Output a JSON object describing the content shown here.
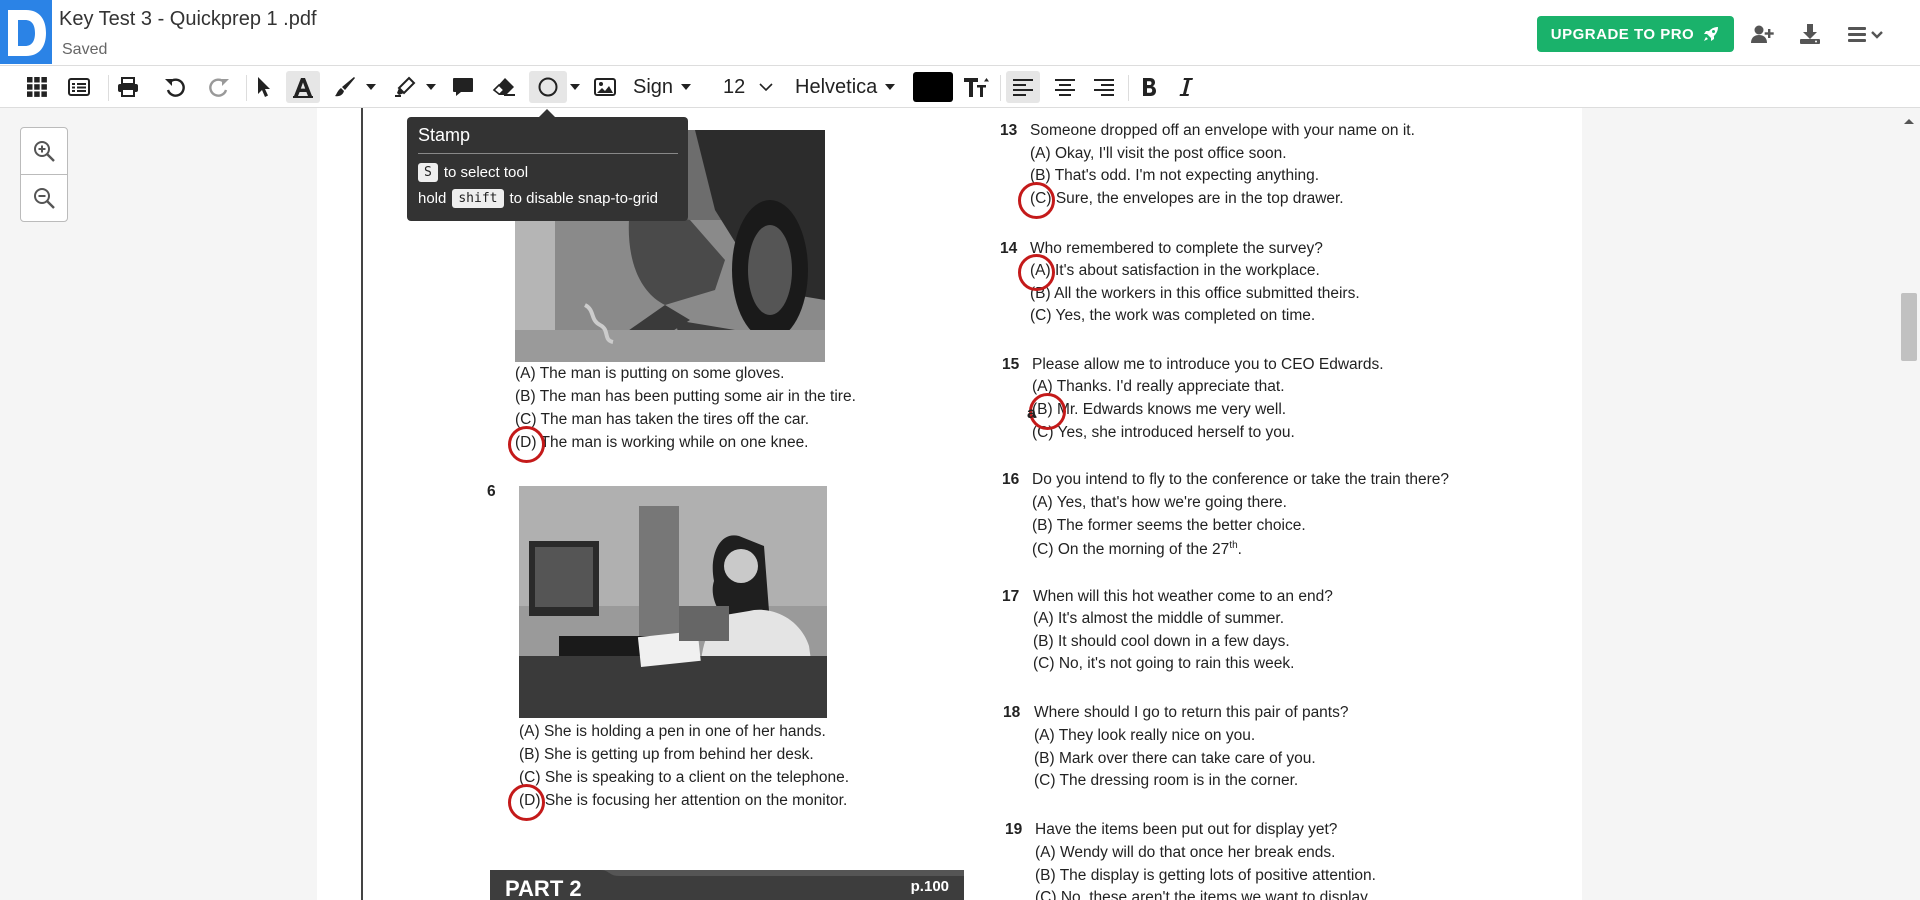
{
  "header": {
    "title": "Key Test 3 - Quickprep 1 .pdf",
    "status": "Saved",
    "upgrade_label": "UPGRADE TO PRO"
  },
  "toolbar": {
    "sign_label": "Sign",
    "font_size": "12",
    "font_family": "Helvetica",
    "text_color": "#000000"
  },
  "tooltip": {
    "title": "Stamp",
    "key1": "S",
    "line1": "to select tool",
    "prefix2": "hold",
    "key2": "shift",
    "line2": "to disable snap-to-grid"
  },
  "colors": {
    "brand": "#2b83e6",
    "upgrade": "#1ab26b",
    "annotation": "#c41a1a"
  },
  "document": {
    "q5": {
      "options": [
        "(A) The man is putting on some gloves.",
        "(B) The man has been putting some air in the tire.",
        "(C) The man has taken the tires off the car.",
        "(D) The man is working while on one knee."
      ]
    },
    "q6": {
      "number": "6",
      "options": [
        "(A) She is holding a pen in one of her hands.",
        "(B) She is getting up from behind her desk.",
        "(C) She is speaking to a client on the telephone.",
        "(D) She is focusing her attention on the monitor."
      ]
    },
    "q13": {
      "number": "13",
      "question": "Someone dropped off an envelope with your name on it.",
      "options": [
        "(A) Okay, I'll visit the post office soon.",
        "(B) That's odd. I'm not expecting anything.",
        "(C) Sure, the envelopes are in the top drawer."
      ]
    },
    "q14": {
      "number": "14",
      "question": "Who remembered to complete the survey?",
      "options": [
        "(A) It's about satisfaction in the workplace.",
        "(B) All the workers in this office submitted theirs.",
        "(C) Yes, the work was completed on time."
      ]
    },
    "q15": {
      "number": "15",
      "question": "Please allow me to introduce you to CEO Edwards.",
      "options": [
        "(A) Thanks. I'd really appreciate that.",
        "(B) Mr. Edwards knows me very well.",
        "(C) Yes, she introduced herself to you."
      ],
      "annotation_text": "a"
    },
    "q16": {
      "number": "16",
      "question": "Do you intend to fly to the conference or take the train there?",
      "options": [
        "(A) Yes, that's how we're going there.",
        "(B) The former seems the better choice.",
        "(C) On the morning of the 27"
      ],
      "superscript": "th",
      "suffix": "."
    },
    "q17": {
      "number": "17",
      "question": "When will this hot weather come to an end?",
      "options": [
        "(A) It's almost the middle of summer.",
        "(B) It should cool down in a few days.",
        "(C) No, it's not going to rain this week."
      ]
    },
    "q18": {
      "number": "18",
      "question": "Where should I go to return this pair of pants?",
      "options": [
        "(A) They look really nice on you.",
        "(B) Mark over there can take care of you.",
        "(C) The dressing room is in the corner."
      ]
    },
    "q19": {
      "number": "19",
      "question": "Have the items been put out for display yet?",
      "options": [
        "(A) Wendy will do that once her break ends.",
        "(B) The display is getting lots of positive attention.",
        "(C) No, these aren't the items we want to display."
      ]
    },
    "part": {
      "label": "PART 2",
      "page": "p.100"
    }
  }
}
